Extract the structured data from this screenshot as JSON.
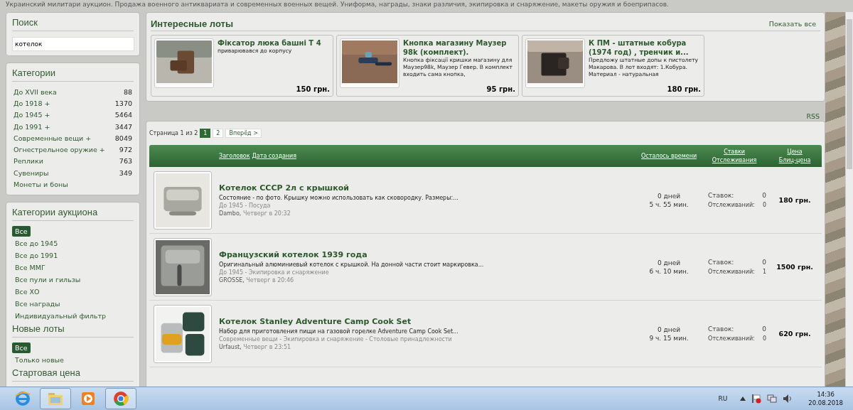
{
  "tagline": "Украинский милитари аукцион. Продажа военного антиквариата и современных военных вещей. Униформа, награды, знаки различия, экипировка и снаряжение, макеты оружия и боеприпасов.",
  "search": {
    "title": "Поиск",
    "value": "котелок"
  },
  "categories": {
    "title": "Категории",
    "items": [
      {
        "label": "До XVII века",
        "count": "88"
      },
      {
        "label": "До 1918 +",
        "count": "1370"
      },
      {
        "label": "До 1945 +",
        "count": "5464"
      },
      {
        "label": "До 1991 +",
        "count": "3447"
      },
      {
        "label": "Современные вещи +",
        "count": "8049"
      },
      {
        "label": "Огнестрельное оружие +",
        "count": "972"
      },
      {
        "label": "Реплики",
        "count": "763"
      },
      {
        "label": "Сувениры",
        "count": "349"
      },
      {
        "label": "Монеты и боны"
      }
    ]
  },
  "auction_categories": {
    "title": "Категории аукциона",
    "items": [
      {
        "label": "Все",
        "selected": true
      },
      {
        "label": "Все до 1945",
        "selected": false
      },
      {
        "label": "Все до 1991",
        "selected": false
      },
      {
        "label": "Все ММГ",
        "selected": false
      },
      {
        "label": "Все пули и гильзы",
        "selected": false
      },
      {
        "label": "Все ХО",
        "selected": false
      },
      {
        "label": "Все награды",
        "selected": false
      },
      {
        "label": "Индивидуальный фильтр",
        "selected": false
      }
    ]
  },
  "new_lots": {
    "title": "Новые лоты",
    "items": [
      {
        "label": "Все",
        "selected": true
      },
      {
        "label": "Только новые",
        "selected": false
      }
    ]
  },
  "start_price": {
    "title": "Стартовая цена"
  },
  "featured": {
    "title": "Интересные лоты",
    "show_all": "Показать все",
    "lots": [
      {
        "title": "Фіксатор люка башні Т 4",
        "description": "приварювався до корпусу",
        "price": "150 грн."
      },
      {
        "title": "Кнопка магазину Маузер 98k (комплект).",
        "description": "Кнопка фіксації кришки магазину для Маузер98k, Маузер Гевер. В комплект входить сама кнопка,",
        "price": "95 грн."
      },
      {
        "title": "К ПМ - штатные кобура (1974 год) , тренчик и...",
        "description": "Предложу штатные допы к пистолету Макарова. В лот входят: 1.Кобура. Материал - натуральная",
        "price": "180 грн."
      }
    ]
  },
  "rss": "RSS",
  "pagination": {
    "label": "Страница 1 из 2",
    "pages": [
      {
        "label": "1",
        "selected": true
      },
      {
        "label": "2",
        "selected": false
      }
    ],
    "next": "Вперёд >"
  },
  "table": {
    "columns": [
      {
        "lines": [
          "Заголовок",
          "Дата создания"
        ],
        "kind": "inline"
      },
      {
        "lines": [
          "Осталось времени"
        ],
        "kind": "stack"
      },
      {
        "lines": [
          "Ставки",
          "Отслеживания"
        ],
        "kind": "stack"
      },
      {
        "lines": [
          "Цена",
          "Блиц-цена"
        ],
        "kind": "stack"
      }
    ],
    "rows": [
      {
        "title": "Котелок СССР 2л с крышкой",
        "description": "Состояние - по фото. Крышку можно использовать как сковородку. Размеры:...",
        "category": "До 1945 - Посуда",
        "author": "Dambo,",
        "date": "Четверг в 20:32",
        "days": "0 дней",
        "hours": "5 ч. 55 мин.",
        "bids_label": "Ставок:",
        "bids": "0",
        "watch_label": "Отслеживаний:",
        "watchers": "0",
        "price": "180 грн."
      },
      {
        "title": "Французский котелок 1939 года",
        "description": "Оригинальный алюминиевый котелок с крышкой. На донной части стоит маркировка...",
        "category": "До 1945 - Экипировка и снаряжение",
        "author": "GROSSE,",
        "date": "Четверг в 20:46",
        "days": "0 дней",
        "hours": "6 ч. 10 мин.",
        "bids_label": "Ставок:",
        "bids": "0",
        "watch_label": "Отслеживаний:",
        "watchers": "1",
        "price": "1500 грн."
      },
      {
        "title": "Котелок Stanley Adventure Camp Cook Set",
        "description": "Набор для приготовления пищи на газовой горелке Adventure Camp Cook Set...",
        "category": "Современные вещи - Экипировка и снаряжение - Столовые принадлежности",
        "author": "Urfaust,",
        "date": "Четверг в 23:51",
        "days": "0 дней",
        "hours": "9 ч. 15 мин.",
        "bids_label": "Ставок:",
        "bids": "0",
        "watch_label": "Отслеживаний:",
        "watchers": "0",
        "price": "620 грн."
      }
    ]
  },
  "taskbar": {
    "apps": [
      {
        "kind": "browser-e",
        "selected": false
      },
      {
        "kind": "folder",
        "selected": true
      },
      {
        "kind": "media",
        "selected": false
      },
      {
        "kind": "chrome",
        "selected": true
      }
    ],
    "language": "RU",
    "time": "14:36",
    "date": "20.08.2018"
  }
}
